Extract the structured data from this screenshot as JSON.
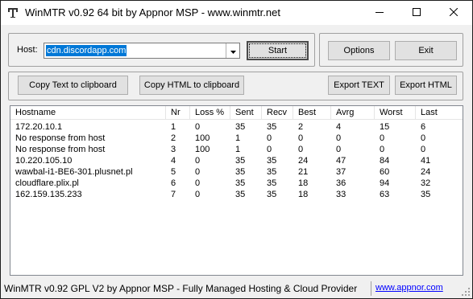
{
  "window": {
    "title": "WinMTR v0.92 64 bit by Appnor MSP - www.winmtr.net"
  },
  "host": {
    "label": "Host:",
    "value": "cdn.discordapp.com",
    "start_label": "Start",
    "options_label": "Options",
    "exit_label": "Exit"
  },
  "toolbar": {
    "copy_text_label": "Copy Text to clipboard",
    "copy_html_label": "Copy HTML to clipboard",
    "export_text_label": "Export TEXT",
    "export_html_label": "Export HTML"
  },
  "table": {
    "columns": [
      "Hostname",
      "Nr",
      "Loss %",
      "Sent",
      "Recv",
      "Best",
      "Avrg",
      "Worst",
      "Last"
    ],
    "rows": [
      [
        "172.20.10.1",
        "1",
        "0",
        "35",
        "35",
        "2",
        "4",
        "15",
        "6"
      ],
      [
        "No response from host",
        "2",
        "100",
        "1",
        "0",
        "0",
        "0",
        "0",
        "0"
      ],
      [
        "No response from host",
        "3",
        "100",
        "1",
        "0",
        "0",
        "0",
        "0",
        "0"
      ],
      [
        "10.220.105.10",
        "4",
        "0",
        "35",
        "35",
        "24",
        "47",
        "84",
        "41"
      ],
      [
        "wawbal-i1-BE6-301.plusnet.pl",
        "5",
        "0",
        "35",
        "35",
        "21",
        "37",
        "60",
        "24"
      ],
      [
        "cloudflare.plix.pl",
        "6",
        "0",
        "35",
        "35",
        "18",
        "36",
        "94",
        "32"
      ],
      [
        "162.159.135.233",
        "7",
        "0",
        "35",
        "35",
        "18",
        "33",
        "63",
        "35"
      ]
    ]
  },
  "status": {
    "text": "WinMTR v0.92 GPL V2 by Appnor MSP - Fully Managed Hosting & Cloud Provider",
    "link": "www.appnor.com"
  },
  "icons": {
    "app": "winmtr-app-icon",
    "minimize": "minimize-icon",
    "maximize": "maximize-icon",
    "close": "close-icon",
    "dropdown": "chevron-down-icon",
    "grip": "resize-grip-icon"
  }
}
